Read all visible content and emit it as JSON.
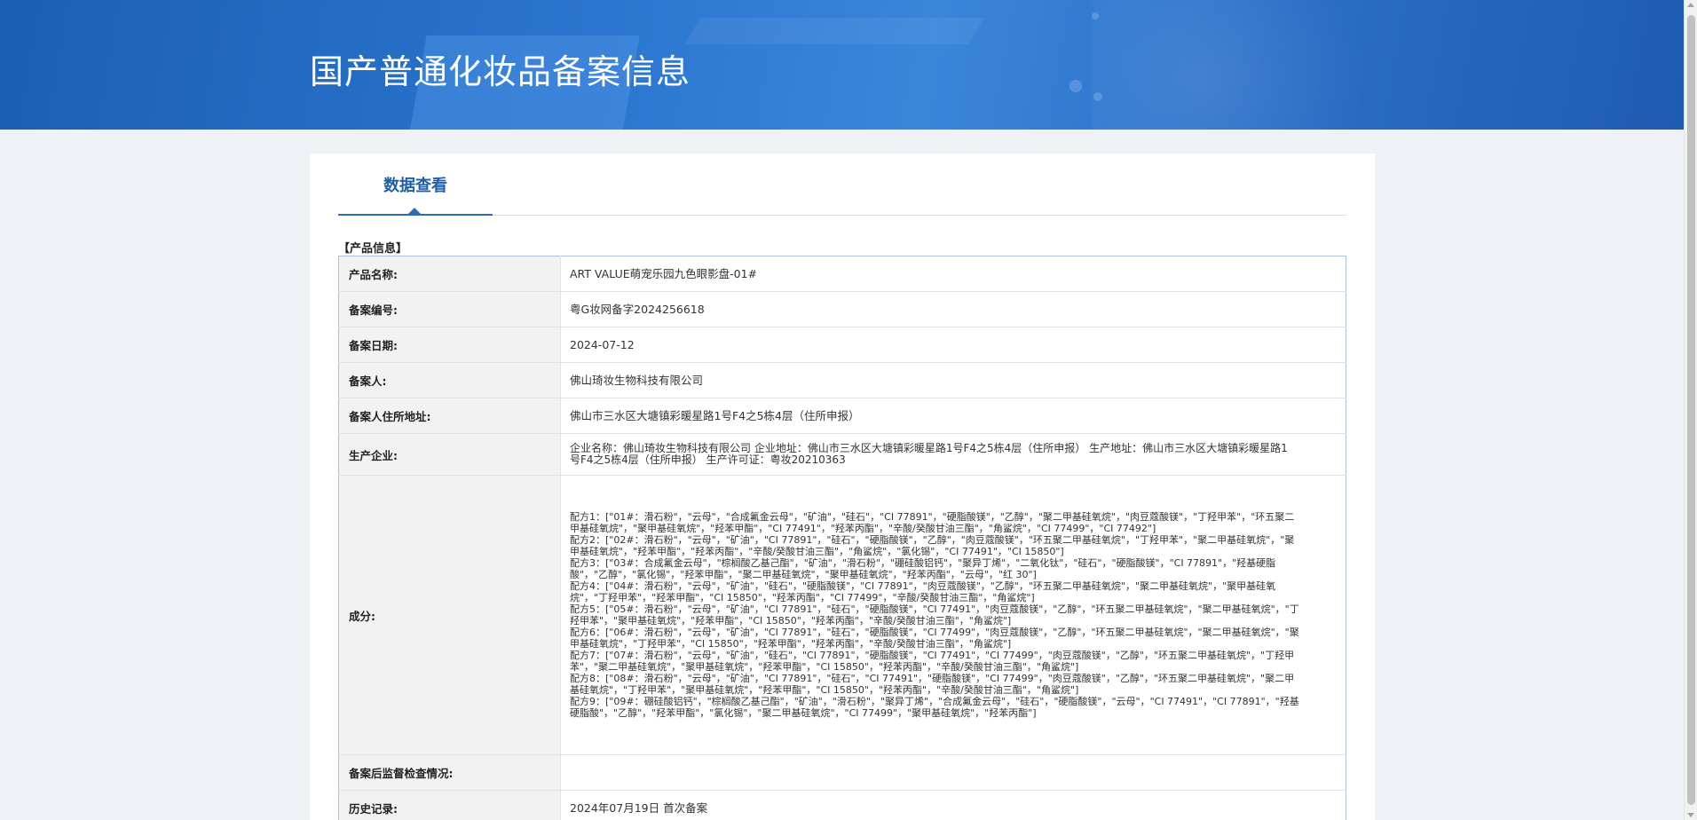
{
  "header": {
    "title": "国产普通化妆品备案信息"
  },
  "tabs": [
    {
      "label": "数据查看",
      "active": true
    }
  ],
  "section_title": "【产品信息】",
  "rows": {
    "product_name": {
      "label": "产品名称:",
      "value": "ART VALUE萌宠乐园九色眼影盘-01#"
    },
    "record_no": {
      "label": "备案编号:",
      "value": "粤G妆网备字2024256618"
    },
    "record_date": {
      "label": "备案日期:",
      "value": "2024-07-12"
    },
    "registrant": {
      "label": "备案人:",
      "value": "佛山琦妆生物科技有限公司"
    },
    "address": {
      "label": "备案人住所地址:",
      "value": "佛山市三水区大塘镇彩暖星路1号F4之5栋4层（住所申报）"
    },
    "manufacturer": {
      "label": "生产企业:",
      "value": "企业名称：佛山琦妆生物科技有限公司 企业地址：佛山市三水区大塘镇彩暖星路1号F4之5栋4层（住所申报） 生产地址：佛山市三水区大塘镇彩暖星路1号F4之5栋4层（住所申报） 生产许可证：粤妆20210363"
    },
    "ingredients": {
      "label": "成分:",
      "formulas": [
        "配方1：[\"01#：滑石粉\"，\"云母\"，\"合成氟金云母\"，\"矿油\"，\"硅石\"，\"CI 77891\"，\"硬脂酸镁\"，\"乙醇\"，\"聚二甲基硅氧烷\"，\"肉豆蔻酸镁\"，\"丁羟甲苯\"，\"环五聚二甲基硅氧烷\"，\"聚甲基硅氧烷\"，\"羟苯甲酯\"，\"CI 77491\"，\"羟苯丙酯\"，\"辛酸/癸酸甘油三酯\"，\"角鲨烷\"，\"CI 77499\"，\"CI 77492\"]",
        "配方2：[\"02#：滑石粉\"，\"云母\"，\"矿油\"，\"CI 77891\"，\"硅石\"，\"硬脂酸镁\"，\"乙醇\"，\"肉豆蔻酸镁\"，\"环五聚二甲基硅氧烷\"，\"丁羟甲苯\"，\"聚二甲基硅氧烷\"，\"聚甲基硅氧烷\"，\"羟苯甲酯\"，\"羟苯丙酯\"，\"辛酸/癸酸甘油三酯\"，\"角鲨烷\"，\"氯化锡\"，\"CI 77491\"，\"CI 15850\"]",
        "配方3：[\"03#：合成氟金云母\"，\"棕榈酸乙基己酯\"，\"矿油\"，\"滑石粉\"，\"硼硅酸铝钙\"，\"聚异丁烯\"，\"二氧化钛\"，\"硅石\"，\"硬脂酸镁\"，\"CI 77891\"，\"羟基硬脂酸\"，\"乙醇\"，\"氯化锡\"，\"羟苯甲酯\"，\"聚二甲基硅氧烷\"，\"聚甲基硅氧烷\"，\"羟苯丙酯\"，\"云母\"，\"红 30\"]",
        "配方4：[\"04#：滑石粉\"，\"云母\"，\"矿油\"，\"硅石\"，\"硬脂酸镁\"，\"CI 77891\"，\"肉豆蔻酸镁\"，\"乙醇\"，\"环五聚二甲基硅氧烷\"，\"聚二甲基硅氧烷\"，\"聚甲基硅氧烷\"，\"丁羟甲苯\"，\"羟苯甲酯\"，\"CI 15850\"，\"羟苯丙酯\"，\"CI 77499\"，\"辛酸/癸酸甘油三酯\"，\"角鲨烷\"]",
        "配方5：[\"05#：滑石粉\"，\"云母\"，\"矿油\"，\"CI 77891\"，\"硅石\"，\"硬脂酸镁\"，\"CI 77491\"，\"肉豆蔻酸镁\"，\"乙醇\"，\"环五聚二甲基硅氧烷\"，\"聚二甲基硅氧烷\"，\"丁羟甲苯\"，\"聚甲基硅氧烷\"，\"羟苯甲酯\"，\"CI 15850\"，\"羟苯丙酯\"，\"辛酸/癸酸甘油三酯\"，\"角鲨烷\"]",
        "配方6：[\"06#：滑石粉\"，\"云母\"，\"矿油\"，\"CI 77891\"，\"硅石\"，\"硬脂酸镁\"，\"CI 77499\"，\"肉豆蔻酸镁\"，\"乙醇\"，\"环五聚二甲基硅氧烷\"，\"聚二甲基硅氧烷\"，\"聚甲基硅氧烷\"，\"丁羟甲苯\"，\"CI 15850\"，\"羟苯甲酯\"，\"羟苯丙酯\"，\"辛酸/癸酸甘油三酯\"，\"角鲨烷\"]",
        "配方7：[\"07#：滑石粉\"，\"云母\"，\"矿油\"，\"硅石\"，\"CI 77891\"，\"硬脂酸镁\"，\"CI 77491\"，\"CI 77499\"，\"肉豆蔻酸镁\"，\"乙醇\"，\"环五聚二甲基硅氧烷\"，\"丁羟甲苯\"，\"聚二甲基硅氧烷\"，\"聚甲基硅氧烷\"，\"羟苯甲酯\"，\"CI 15850\"，\"羟苯丙酯\"，\"辛酸/癸酸甘油三酯\"，\"角鲨烷\"]",
        "配方8：[\"08#：滑石粉\"，\"云母\"，\"矿油\"，\"CI 77891\"，\"硅石\"，\"CI 77491\"，\"硬脂酸镁\"，\"CI 77499\"，\"肉豆蔻酸镁\"，\"乙醇\"，\"环五聚二甲基硅氧烷\"，\"聚二甲基硅氧烷\"，\"丁羟甲苯\"，\"聚甲基硅氧烷\"，\"羟苯甲酯\"，\"CI 15850\"，\"羟苯丙酯\"，\"辛酸/癸酸甘油三酯\"，\"角鲨烷\"]",
        "配方9：[\"09#：硼硅酸铝钙\"，\"棕榈酸乙基己酯\"，\"矿油\"，\"滑石粉\"，\"聚异丁烯\"，\"合成氟金云母\"，\"硅石\"，\"硬脂酸镁\"，\"云母\"，\"CI 77491\"，\"CI 77891\"，\"羟基硬脂酸\"，\"乙醇\"，\"羟苯甲酯\"，\"氯化锡\"，\"聚二甲基硅氧烷\"，\"CI 77499\"，\"聚甲基硅氧烷\"，\"羟苯丙酯\"]"
      ]
    },
    "post_check": {
      "label": "备案后监督检查情况:",
      "value": ""
    },
    "history": {
      "label": "历史记录:",
      "value": "2024年07月19日 首次备案"
    }
  }
}
